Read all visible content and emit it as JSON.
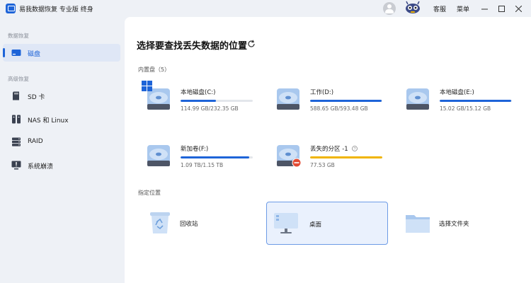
{
  "titlebar": {
    "app_title": "易我数据恢复 专业版 终身",
    "account_label": "客服",
    "menu_label": "菜单",
    "minimize_icon": "minimize-icon",
    "maximize_icon": "maximize-icon",
    "close_icon": "close-icon"
  },
  "sidebar": {
    "section_recovery": "数据恢复",
    "section_advanced": "高级恢复",
    "items": [
      {
        "label": "磁盘",
        "icon": "disk-icon",
        "active": true
      },
      {
        "label": "SD 卡",
        "icon": "sd-card-icon",
        "active": false
      },
      {
        "label": "NAS 和 Linux",
        "icon": "nas-icon",
        "active": false
      },
      {
        "label": "RAID",
        "icon": "raid-icon",
        "active": false
      },
      {
        "label": "系统崩溃",
        "icon": "crash-icon",
        "active": false
      }
    ]
  },
  "main": {
    "title": "选择要查找丢失数据的位置",
    "internal_label": "内置盘（5）",
    "drives": [
      {
        "name": "本地磁盘(C:)",
        "size": "114.99 GB/232.35 GB",
        "used_fraction": 0.49,
        "icon": "system-disk-icon"
      },
      {
        "name": "工作(D:)",
        "size": "588.65 GB/593.48 GB",
        "used_fraction": 0.99,
        "icon": "disk-icon"
      },
      {
        "name": "本地磁盘(E:)",
        "size": "15.02 GB/15.12 GB",
        "used_fraction": 0.99,
        "icon": "disk-icon"
      },
      {
        "name": "新加卷(F:)",
        "size": "1.09 TB/1.15 TB",
        "used_fraction": 0.95,
        "icon": "disk-icon"
      },
      {
        "name": "丢失的分区 -1",
        "size": "77.53 GB",
        "used_fraction": 1.0,
        "icon": "lost-partition-icon"
      }
    ],
    "location_label": "指定位置",
    "locations": [
      {
        "label": "回收站",
        "icon": "recycle-bin-icon"
      },
      {
        "label": "桌面",
        "icon": "desktop-icon"
      },
      {
        "label": "选择文件夹",
        "icon": "folder-icon"
      }
    ]
  },
  "colors": {
    "accent": "#1e64d8",
    "warning": "#f0b400",
    "sidebar_bg": "#eef1f6",
    "selected_bg": "#eaf1fd"
  }
}
